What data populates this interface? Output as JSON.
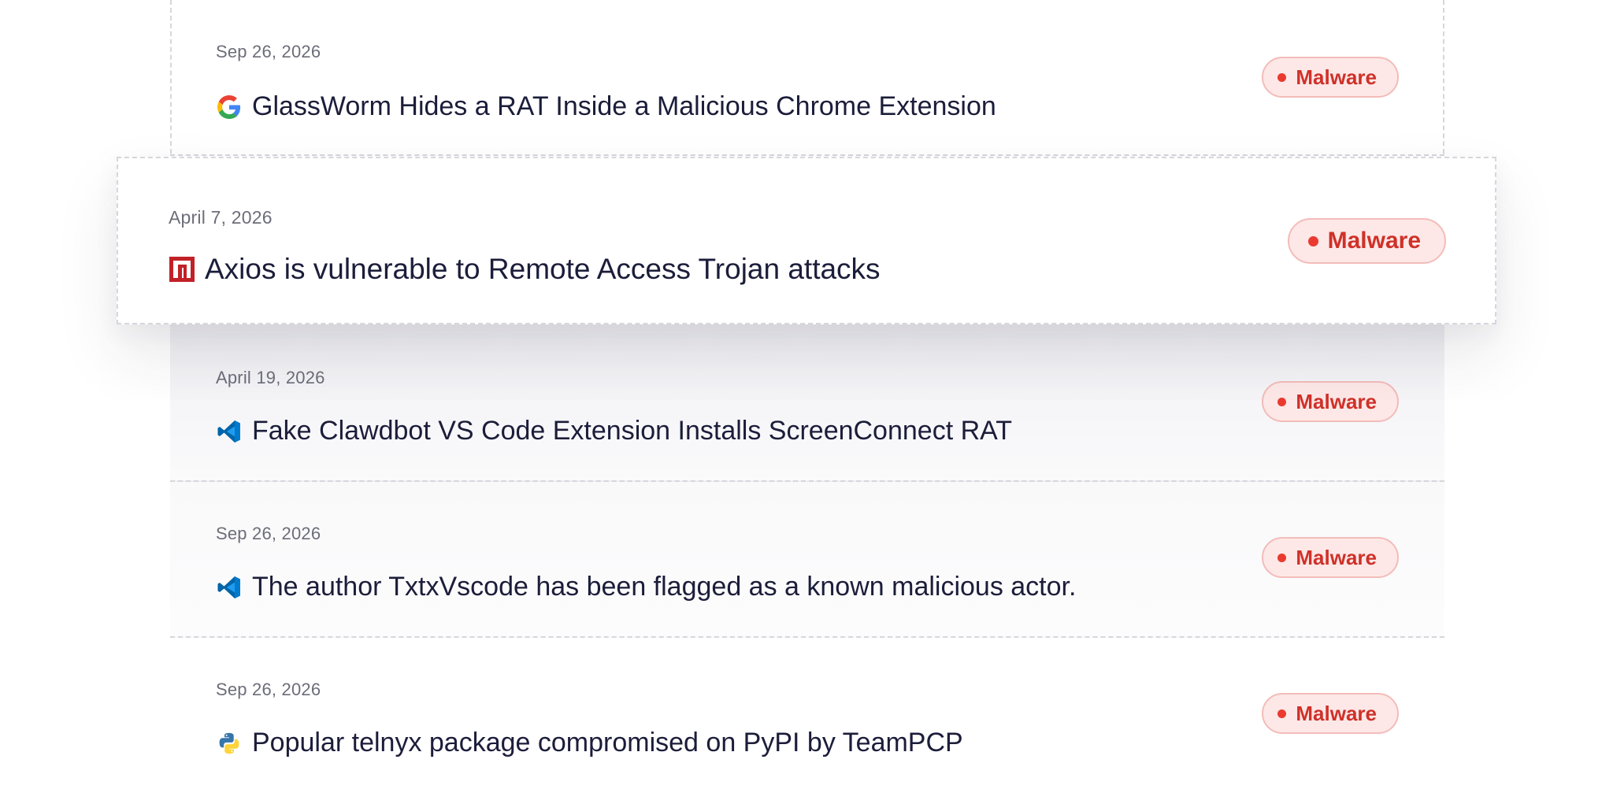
{
  "items": [
    {
      "date": "Sep 26, 2026",
      "icon": "google-icon",
      "title": "GlassWorm Hides a RAT Inside a Malicious Chrome Extension",
      "badge": "Malware"
    },
    {
      "date": "April 7, 2026",
      "icon": "npm-icon",
      "title": "Axios is vulnerable to Remote Access Trojan attacks",
      "badge": "Malware"
    },
    {
      "date": "April 19, 2026",
      "icon": "vscode-icon",
      "title": "Fake Clawdbot VS Code Extension Installs ScreenConnect RAT",
      "badge": "Malware"
    },
    {
      "date": "Sep 26, 2026",
      "icon": "vscode-icon",
      "title": "The author TxtxVscode has been flagged as a known malicious actor.",
      "badge": "Malware"
    },
    {
      "date": "Sep 26, 2026",
      "icon": "python-icon",
      "title": "Popular telnyx package compromised on PyPI by TeamPCP",
      "badge": "Malware"
    }
  ],
  "colors": {
    "badge_text": "#cf3129",
    "badge_bg": "#fde8e7",
    "badge_dot": "#ea3a30",
    "title_text": "#1b1d3a",
    "date_text": "#6d6d7a"
  }
}
